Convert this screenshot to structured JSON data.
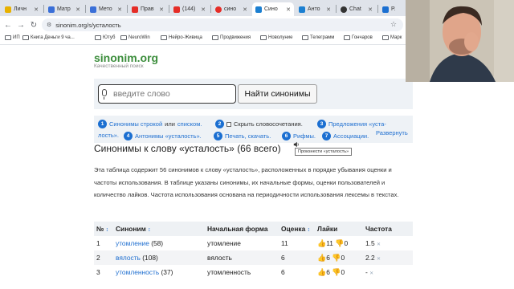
{
  "browser": {
    "tabs": [
      {
        "label": "Личн",
        "color": "#e8b100"
      },
      {
        "label": "Матр",
        "color": "#3a6fd8"
      },
      {
        "label": "Мето",
        "color": "#3a6fd8"
      },
      {
        "label": "Прав",
        "color": "#e52d27"
      },
      {
        "label": "(144)",
        "color": "#e52d27"
      },
      {
        "label": "сино",
        "color": "#e52d27"
      },
      {
        "label": "Сино",
        "color": "#1b7fd1"
      },
      {
        "label": "Анто",
        "color": "#1b7fd1"
      },
      {
        "label": "Chat",
        "color": "#333333"
      },
      {
        "label": "Р.",
        "color": "#1b6fd1"
      }
    ],
    "url": "sinonim.org/s/усталость",
    "bookmarks": [
      "ИП",
      "Книга Деньги 9 ча...",
      "Ютуб",
      "NeuroWin",
      "Нейро-Живица",
      "Продвижения",
      "Новолуние",
      "Телеграмм",
      "Гончаров",
      "Марк"
    ]
  },
  "site": {
    "logo": "sinonim.org",
    "tagline": "Качественный поиск",
    "search": {
      "placeholder": "введите слово",
      "button": "Найти синонимы"
    },
    "toc": {
      "i1": {
        "num": "1",
        "a": "Синонимы строкой",
        "or": "или",
        "b": "списком."
      },
      "i2": {
        "num": "2",
        "label": "Скрыть словосочетания."
      },
      "i3": {
        "num": "3",
        "label": "Предложения «уста-"
      },
      "i3b": {
        "label": "лость»."
      },
      "i4": {
        "num": "4",
        "label": "Антонимы «усталость»."
      },
      "i5": {
        "num": "5",
        "label": "Печать, скачать."
      },
      "i6": {
        "num": "6",
        "label": "Рифмы."
      },
      "i7": {
        "num": "7",
        "label": "Ассоциации."
      },
      "expand": "Развернуть"
    },
    "tooltip": "Произнести «усталость»",
    "heading": "Синонимы к слову «усталость» (66 всего)",
    "paragraph": "Эта таблица содержит 56 синонимов к слову «усталость», расположенных в порядке убывания оценки и частоты использования. В таблице указаны синонимы, их начальные формы, оценки пользователей и количество лайков. Частота использования основана на периодичности использования лексемы в текстах.",
    "table": {
      "headers": [
        "№",
        "Синоним",
        "Начальная форма",
        "Оценка",
        "Лайки",
        "Частота"
      ],
      "rows": [
        {
          "n": "1",
          "word": "утомление",
          "count": "(58)",
          "form": "утомление",
          "score": "11",
          "likes": "11",
          "dislikes": "0",
          "freq": "1.5"
        },
        {
          "n": "2",
          "word": "вялость",
          "count": "(108)",
          "form": "вялость",
          "score": "6",
          "likes": "6",
          "dislikes": "0",
          "freq": "2.2"
        },
        {
          "n": "3",
          "word": "утомленность",
          "count": "(37)",
          "form": "утомленность",
          "score": "6",
          "likes": "6",
          "dislikes": "0",
          "freq": "-"
        }
      ]
    }
  }
}
